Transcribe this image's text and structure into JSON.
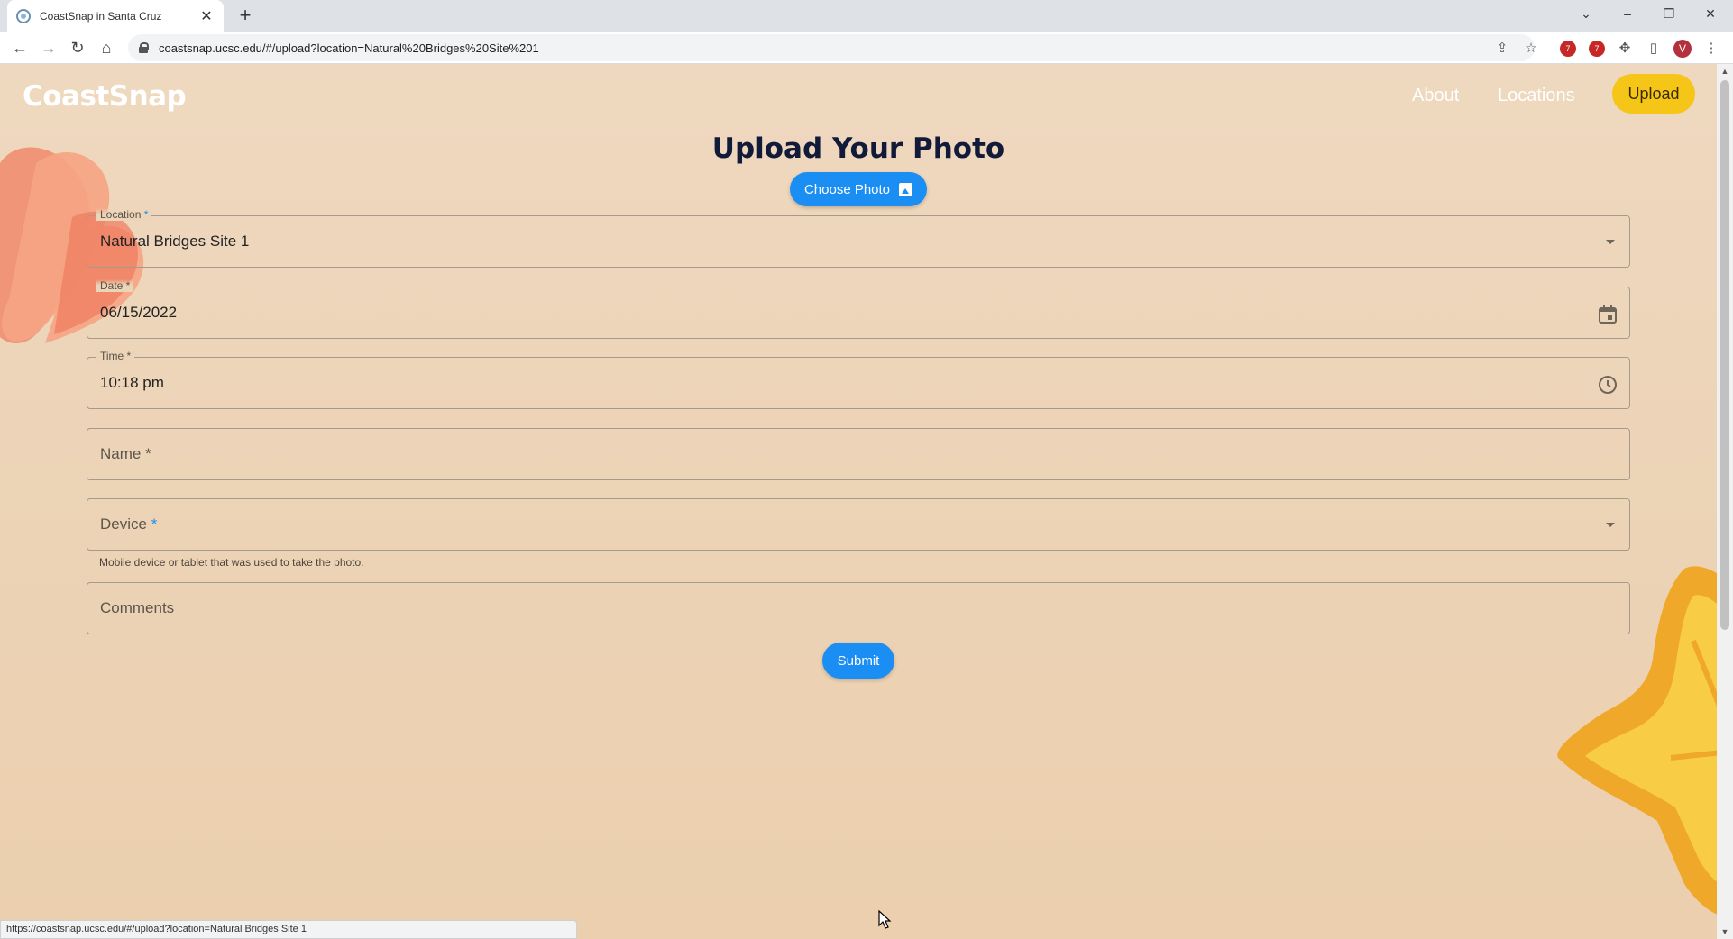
{
  "browser": {
    "tab_title": "CoastSnap in Santa Cruz",
    "url": "coastsnap.ucsc.edu/#/upload?location=Natural%20Bridges%20Site%201",
    "avatar_letter": "V",
    "ext_badge_1": "7",
    "ext_badge_2": "7",
    "status_url": "https://coastsnap.ucsc.edu/#/upload?location=Natural Bridges Site 1"
  },
  "header": {
    "brand": "CoastSnap",
    "nav": {
      "about": "About",
      "locations": "Locations",
      "upload": "Upload"
    }
  },
  "form": {
    "title": "Upload Your Photo",
    "choose_photo_label": "Choose Photo",
    "location": {
      "label": "Location",
      "required_mark": "*",
      "value": "Natural Bridges Site 1"
    },
    "date": {
      "label": "Date *",
      "value": "06/15/2022"
    },
    "time": {
      "label": "Time *",
      "value": "10:18 pm"
    },
    "name": {
      "placeholder": "Name *"
    },
    "device": {
      "placeholder": "Device",
      "required_mark": "*",
      "helper": "Mobile device or tablet that was used to take the photo."
    },
    "comments": {
      "placeholder": "Comments"
    },
    "submit_label": "Submit"
  },
  "colors": {
    "accent": "#1a8ef2",
    "upload_button": "#f5c518",
    "heading": "#111a38",
    "background_top": "#eed8bf",
    "background_bottom": "#ebcfae"
  },
  "icons": {
    "date_adornment": "calendar-icon",
    "time_adornment": "clock-icon",
    "select_adornment": "chevron-down-icon",
    "choose_photo": "image-icon"
  }
}
